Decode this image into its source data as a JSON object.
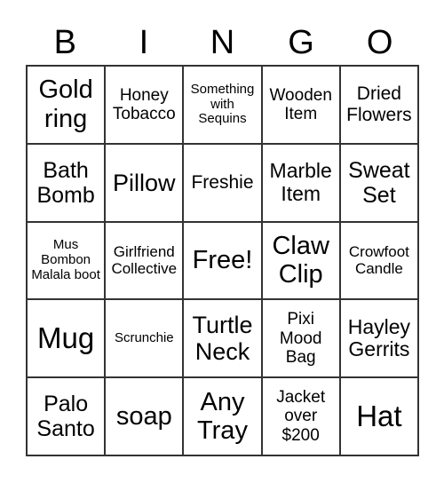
{
  "header": [
    "B",
    "I",
    "N",
    "G",
    "O"
  ],
  "cells": [
    "Gold ring",
    "Honey Tobacco",
    "Something with Sequins",
    "Wooden Item",
    "Dried Flowers",
    "Bath Bomb",
    "Pillow",
    "Freshie",
    "Marble Item",
    "Sweat Set",
    "Mus Bombon Malala boot",
    "Girlfriend Collective",
    "Free!",
    "Claw Clip",
    "Crowfoot Candle",
    "Mug",
    "Scrunchie",
    "Turtle Neck",
    "Pixi Mood Bag",
    "Hayley Gerrits",
    "Palo Santo",
    "soap",
    "Any Tray",
    "Jacket over $200",
    "Hat"
  ]
}
